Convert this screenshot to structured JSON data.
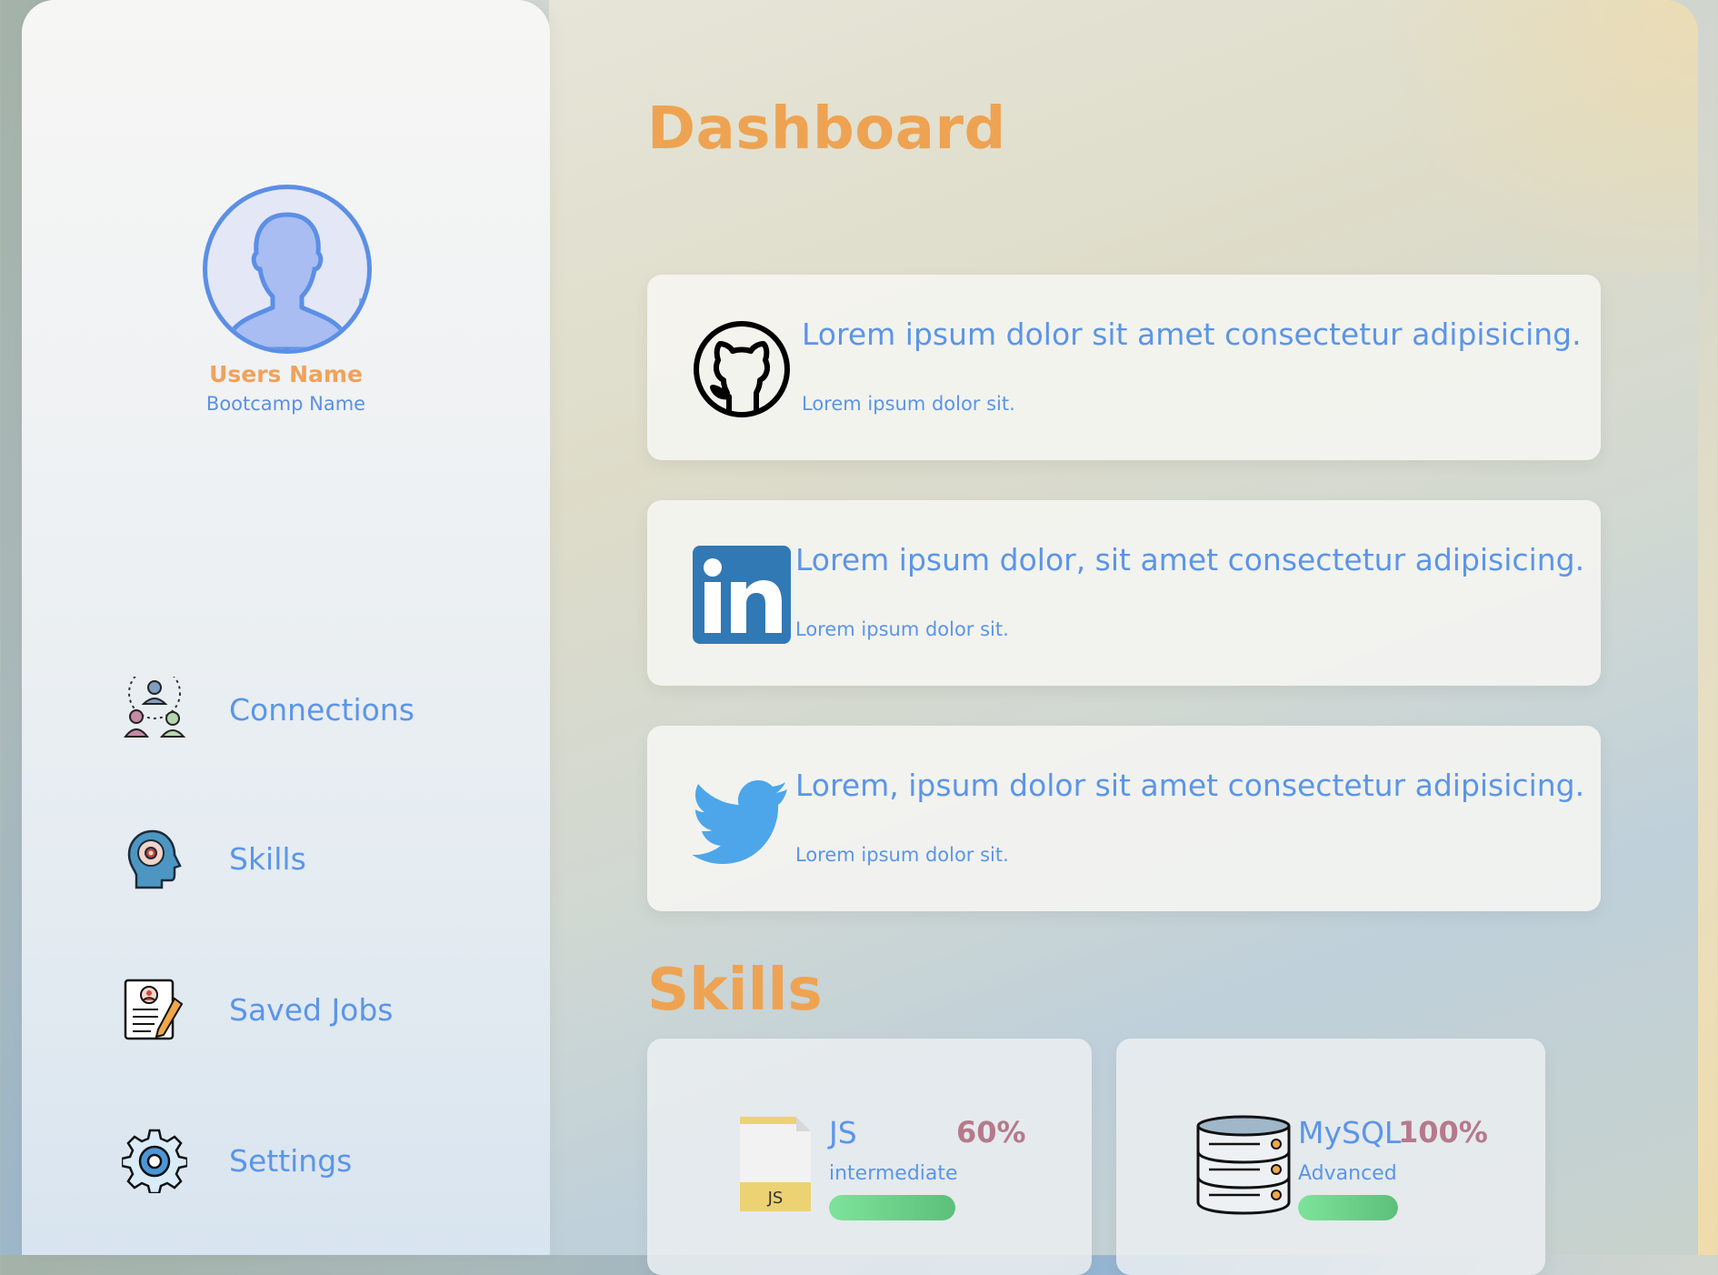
{
  "sidebar": {
    "user_name": "Users Name",
    "bootcamp_name": "Bootcamp Name",
    "items": [
      {
        "label": "Connections",
        "icon": "connections-icon"
      },
      {
        "label": "Skills",
        "icon": "skills-head-icon"
      },
      {
        "label": "Saved Jobs",
        "icon": "saved-jobs-icon"
      },
      {
        "label": "Settings",
        "icon": "settings-gear-icon"
      }
    ]
  },
  "main": {
    "dashboard_title": "Dashboard",
    "cards": [
      {
        "icon": "github-icon",
        "title": "Lorem ipsum dolor sit amet consectetur adipisicing.",
        "subtitle": "Lorem ipsum dolor sit."
      },
      {
        "icon": "linkedin-icon",
        "title": "Lorem ipsum dolor, sit amet consectetur adipisicing.",
        "subtitle": "Lorem ipsum dolor sit."
      },
      {
        "icon": "twitter-icon",
        "title": "Lorem, ipsum dolor sit amet consectetur adipisicing.",
        "subtitle": "Lorem ipsum dolor sit."
      }
    ],
    "skills_title": "Skills",
    "skills": [
      {
        "icon": "js-file-icon",
        "icon_text": "JS",
        "name": "JS",
        "percent": "60%",
        "level": "intermediate",
        "progress": 0.6
      },
      {
        "icon": "database-icon",
        "name": "MySQL",
        "percent": "100%",
        "level": "Advanced",
        "progress": 1.0
      }
    ]
  },
  "colors": {
    "accent_orange": "#eea352",
    "accent_blue": "#5b95e8",
    "percent_mauve": "#b57a8a",
    "progress_green": "#6fd38c"
  }
}
